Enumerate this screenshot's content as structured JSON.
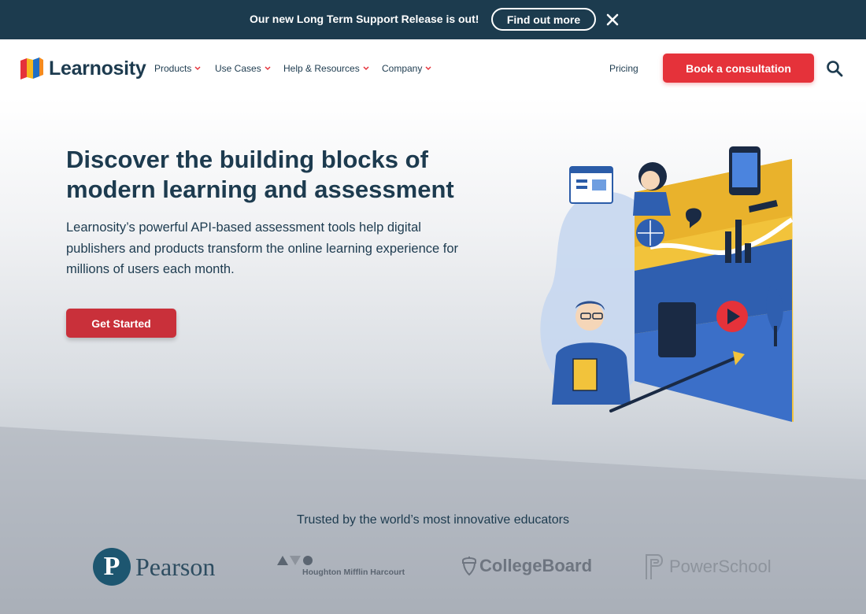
{
  "announcement": {
    "text": "Our new Long Term Support Release is out!",
    "cta_label": "Find out more",
    "close_icon": "close-icon"
  },
  "header": {
    "logo_text": "Learnosity",
    "nav": [
      {
        "label": "Products"
      },
      {
        "label": "Use Cases"
      },
      {
        "label": "Help & Resources"
      },
      {
        "label": "Company"
      }
    ],
    "pricing_label": "Pricing",
    "book_label": "Book a consultation",
    "search_icon": "search-icon"
  },
  "hero": {
    "title_line1": "Discover the building blocks of",
    "title_line2": "modern learning and assessment",
    "description": "Learnosity’s powerful API-based assessment tools help digital publishers and products transform the online learning experience for millions of users each month.",
    "cta_label": "Get Started"
  },
  "trusted": {
    "heading": "Trusted by the world’s most innovative educators",
    "logos": [
      {
        "name": "Pearson",
        "mark": "P"
      },
      {
        "name": "Houghton Mifflin Harcourt"
      },
      {
        "name": "CollegeBoard"
      },
      {
        "name": "PowerSchool"
      }
    ]
  },
  "colors": {
    "navy": "#1c3b4e",
    "brand_red": "#e5323a",
    "cta_red": "#c9303a"
  }
}
